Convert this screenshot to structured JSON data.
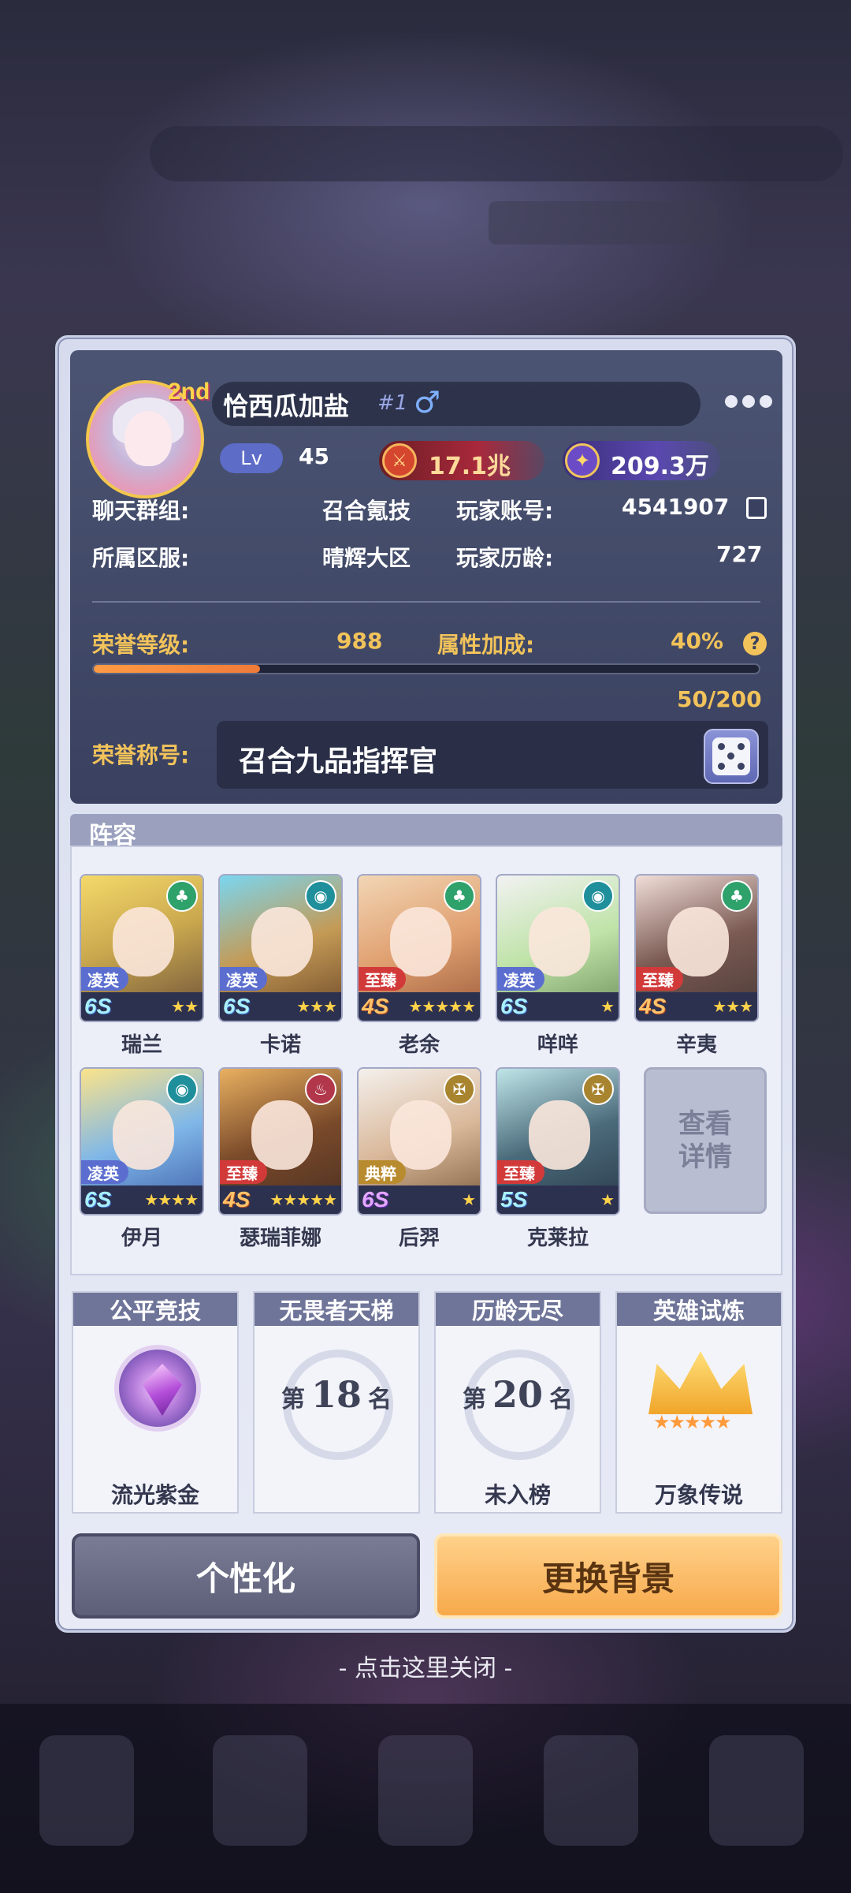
{
  "profile": {
    "name": "恰西瓜加盐",
    "rank_tag": "#1",
    "gender_icon": "male-icon",
    "level_label": "Lv",
    "level": "45",
    "power": "17.1兆",
    "stars": "209.3万",
    "avatar_badge": "2nd"
  },
  "info": {
    "chat_group_label": "聊天群组:",
    "chat_group_value": "召合氪技",
    "account_label": "玩家账号:",
    "account_value": "4541907",
    "server_label": "所属区服:",
    "server_value": "晴辉大区",
    "age_label": "玩家历龄:",
    "age_value": "727"
  },
  "honor": {
    "level_label": "荣誉等级:",
    "level_value": "988",
    "bonus_label": "属性加成:",
    "bonus_value": "40%",
    "progress_text": "50/200",
    "progress_fraction": 0.25,
    "title_label": "荣誉称号:",
    "title_value": "召合九品指挥官"
  },
  "lineup": {
    "title": "阵容",
    "heroes": [
      {
        "name": "瑞兰",
        "tag": "凌英",
        "stage": "6S",
        "stars": "★★",
        "class_icon": "leaf-icon"
      },
      {
        "name": "卡诺",
        "tag": "凌英",
        "stage": "6S",
        "stars": "★★★",
        "class_icon": "swirl-icon"
      },
      {
        "name": "老余",
        "tag": "至臻",
        "stage": "4S",
        "stars": "★★★★★",
        "class_icon": "leaf-icon"
      },
      {
        "name": "咩咩",
        "tag": "凌英",
        "stage": "6S",
        "stars": "★",
        "class_icon": "swirl-icon"
      },
      {
        "name": "辛夷",
        "tag": "至臻",
        "stage": "4S",
        "stars": "★★★",
        "class_icon": "leaf-icon"
      },
      {
        "name": "伊月",
        "tag": "凌英",
        "stage": "6S",
        "stars": "★★★★",
        "class_icon": "swirl-icon"
      },
      {
        "name": "瑟瑞菲娜",
        "tag": "至臻",
        "stage": "4S",
        "stars": "★★★★★",
        "class_icon": "flame-icon"
      },
      {
        "name": "后羿",
        "tag": "典粹",
        "stage": "6S",
        "stars": "★",
        "class_icon": "crest-icon"
      },
      {
        "name": "克莱拉",
        "tag": "至臻",
        "stage": "5S",
        "stars": "★",
        "class_icon": "crest-icon"
      }
    ],
    "view_detail": "查看详情"
  },
  "rankings": [
    {
      "title": "公平竞技",
      "footer": "流光紫金",
      "icon": "amethyst-rank-icon"
    },
    {
      "title": "无畏者天梯",
      "prefix": "第",
      "number": "18",
      "suffix": "名",
      "footer": ""
    },
    {
      "title": "历龄无尽",
      "prefix": "第",
      "number": "20",
      "suffix": "名",
      "footer": "未入榜"
    },
    {
      "title": "英雄试炼",
      "footer": "万象传说",
      "icon": "crown-rank-icon",
      "stars": "★★★★★"
    }
  ],
  "buttons": {
    "personalize": "个性化",
    "change_bg": "更换背景"
  },
  "close_hint": "- 点击这里关闭 -",
  "colors": {
    "accent_gold": "#f2c35a",
    "progress": "#f07b3a",
    "panel_dark": "#3a4160"
  }
}
